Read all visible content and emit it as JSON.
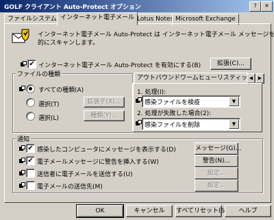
{
  "window": {
    "title": "GOLF クライアント Auto-Protect オプション"
  },
  "tabs": [
    "ファイルシステム",
    "インターネット電子メール",
    "Lotus Notes",
    "Microsoft Exchange"
  ],
  "description": {
    "line1": "インターネット電子メール Auto-Protect は インターネット電子メール メッセージを検閲",
    "line2": "的にスキャンします。"
  },
  "enable": {
    "label": "インターネット電子メール Auto-Protect を有効にする(B)",
    "checked": "✔"
  },
  "extend_button": "拡張(C)...",
  "file_types": {
    "title": "ファイルの種類",
    "all_label": "すべての種類(A)",
    "select1_label": "選択(T)",
    "select2_label": "選択(L)",
    "ext_button": "拡張子(X)...",
    "type_button": "種類(Y)..."
  },
  "outbound": {
    "tab_label": "アウトバウンドワームヒューリスティック",
    "nav_left": "◀",
    "nav_right": "▶",
    "action1_label": "1. 処理(I):",
    "action1_value": "感染ファイルを検疫",
    "action2_label": "2. 処理が失敗した場合(2):",
    "action2_value": "感染ファイルを削除"
  },
  "notification": {
    "title": "通知",
    "items": [
      {
        "label": "感染したコンピュータにメッセージを表示する(D)",
        "checked": "✔",
        "button": "メッセージ(G)..."
      },
      {
        "label": "電子メールメッセージに警告を挿入する(W)",
        "checked": "✔",
        "button": "警告(N)..."
      },
      {
        "label": "送信者に電子メールを送信する(U)",
        "checked": "",
        "button": "設定..."
      },
      {
        "label": "電子メールの送信先(M)",
        "checked": "",
        "button": "設定..."
      }
    ]
  },
  "footer": {
    "ok": "OK",
    "cancel": "キャンセル",
    "reset": "すべてリセット(S)...",
    "help": "ヘルプ"
  },
  "titlebar_buttons": {
    "help": "?",
    "close": "✕"
  },
  "colors": {
    "titlebar_start": "#0a246a",
    "titlebar_end": "#a6caf0",
    "face": "#d4d0c8"
  }
}
